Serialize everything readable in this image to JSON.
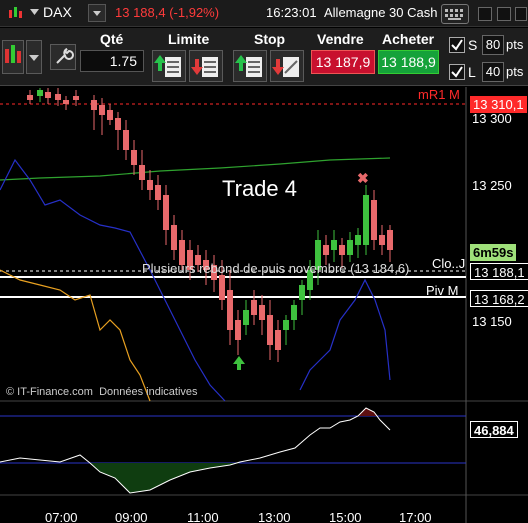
{
  "titlebar": {
    "symbol": "DAX",
    "price_change": "13 188,4 (-1,92%)",
    "time": "16:23:01",
    "instrument_name": "Allemagne 30 Cash ("
  },
  "toolbar": {
    "qty_label": "Qté",
    "qty_value": "1.75",
    "limit_label": "Limite",
    "stop_label": "Stop",
    "sell_label": "Vendre",
    "sell_price": "13 187,9",
    "buy_label": "Acheter",
    "buy_price": "13 188,9",
    "s_label": "S",
    "s_value": "80",
    "l_label": "L",
    "l_value": "40",
    "pts_unit": "pts"
  },
  "chart": {
    "annotation_trade": "Trade 4",
    "annotation_rebound": "Plusieurs rebond de puis novembre (13 184,6)",
    "level_mr1": "mR1 M",
    "level_mr1_price": "13 310,1",
    "level_clo": "Clo..J",
    "level_clo_price": "13 188,1",
    "level_piv": "Piv M",
    "level_piv_price": "13 168,2",
    "countdown": "6m59s",
    "y_ticks": [
      "13 300",
      "13 250",
      "13 150"
    ],
    "x_ticks": [
      "07:00",
      "09:00",
      "11:00",
      "13:00",
      "15:00",
      "17:00"
    ],
    "watermark": "© IT-Finance.com  Données indicatives",
    "osc_value": "46,884",
    "colors": {
      "up": "#3ec13e",
      "down": "#e8696b",
      "level_mr1": "#ff2a2a",
      "ma_green": "#2fa32f",
      "blue_line": "#2630c8",
      "orange_line": "#e8a020"
    }
  }
}
